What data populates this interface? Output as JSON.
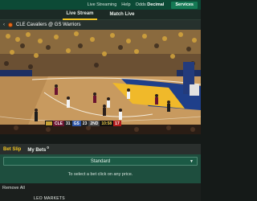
{
  "topbar": {
    "menu": [
      "Live Streaming",
      "Help",
      "Odds"
    ],
    "odds_value": "Decimal",
    "services_label": "Services"
  },
  "tabs": {
    "live_stream": "Live Stream",
    "match_live": "Match Live"
  },
  "event": {
    "title": "CLE Cavaliers @ GS Warriors"
  },
  "scorebug": {
    "team1": "CLE",
    "score1": "31",
    "team2": "GS",
    "score2": "23",
    "quarter": "2ND",
    "clock": "10:58",
    "shot_clock": "17"
  },
  "betslip": {
    "tab_active": "Bet Slip",
    "tab_inactive": "My Bets",
    "my_bets_count": "0",
    "select_value": "Standard",
    "hint": "To select a bet click on any price.",
    "remove_all": "Remove All",
    "partial_text": "LEO MARKETS"
  },
  "colors": {
    "brand_dark": "#0c4a36",
    "accent": "#f2c522",
    "slip_bg": "#1e4e3e"
  }
}
